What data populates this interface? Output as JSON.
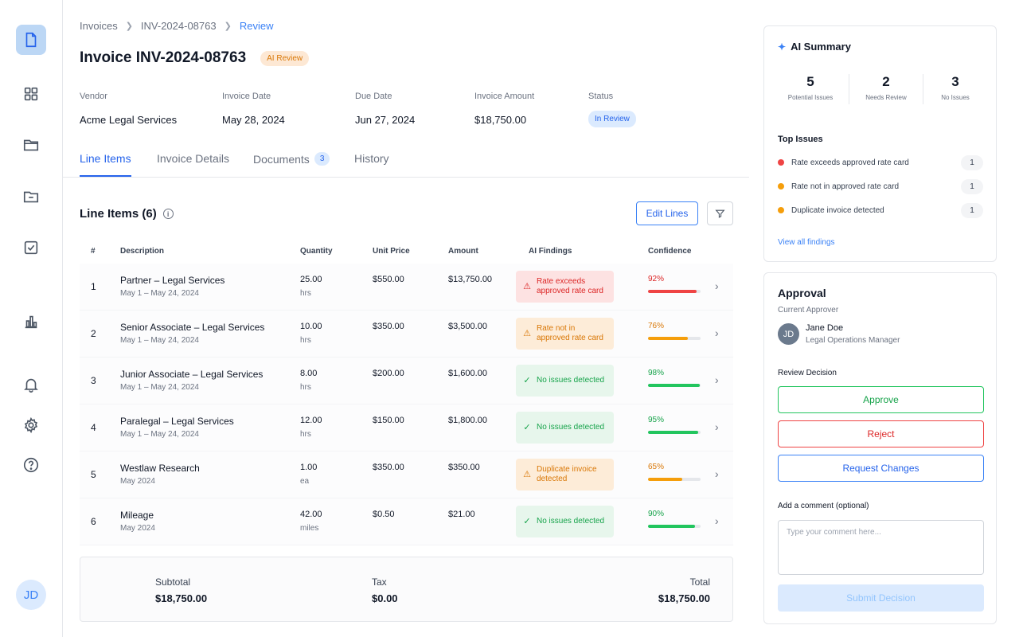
{
  "sidebar": {
    "icons": [
      "document-icon",
      "grid-icon",
      "folder-icon",
      "folder-icon",
      "checkbox-icon",
      "bar-chart-icon",
      "bell-icon",
      "gear-icon",
      "help-icon"
    ],
    "avatar": "JD"
  },
  "breadcrumb": {
    "items": [
      "Invoices",
      "INV-2024-08763",
      "Review"
    ]
  },
  "header": {
    "title": "Invoice INV-2024-08763",
    "badge": "AI Review"
  },
  "meta": {
    "vendor_label": "Vendor",
    "vendor": "Acme Legal Services",
    "invoice_date_label": "Invoice Date",
    "invoice_date": "May 28, 2024",
    "due_date_label": "Due Date",
    "due_date": "Jun 27, 2024",
    "amount_label": "Invoice Amount",
    "amount": "$18,750.00",
    "status_label": "Status",
    "status": "In Review"
  },
  "tabs": [
    {
      "label": "Line Items"
    },
    {
      "label": "Invoice Details"
    },
    {
      "label": "Documents",
      "count": "3"
    },
    {
      "label": "History"
    }
  ],
  "line_items": {
    "title": "Line Items (6)",
    "edit_label": "Edit Lines",
    "columns": [
      "#",
      "Description",
      "Quantity",
      "Unit Price",
      "Amount",
      "AI Findings",
      "Confidence"
    ],
    "rows": [
      {
        "num": "1",
        "desc": "Partner – Legal Services",
        "period": "May 1 – May 24, 2024",
        "qty": "25.00",
        "unit": "hrs",
        "price": "$550.00",
        "amount": "$13,750.00",
        "finding": "Rate exceeds approved rate card",
        "level": "red",
        "confidence": "92%",
        "conf_value": 0.92
      },
      {
        "num": "2",
        "desc": "Senior Associate – Legal Services",
        "period": "May 1 – May 24, 2024",
        "qty": "10.00",
        "unit": "hrs",
        "price": "$350.00",
        "amount": "$3,500.00",
        "finding": "Rate not in approved rate card",
        "level": "orange",
        "confidence": "76%",
        "conf_value": 0.76
      },
      {
        "num": "3",
        "desc": "Junior Associate – Legal Services",
        "period": "May 1 – May 24, 2024",
        "qty": "8.00",
        "unit": "hrs",
        "price": "$200.00",
        "amount": "$1,600.00",
        "finding": "No issues detected",
        "level": "green",
        "confidence": "98%",
        "conf_value": 0.98
      },
      {
        "num": "4",
        "desc": "Paralegal – Legal Services",
        "period": "May 1 – May 24, 2024",
        "qty": "12.00",
        "unit": "hrs",
        "price": "$150.00",
        "amount": "$1,800.00",
        "finding": "No issues detected",
        "level": "green",
        "confidence": "95%",
        "conf_value": 0.95
      },
      {
        "num": "5",
        "desc": "Westlaw Research",
        "period": "May 2024",
        "qty": "1.00",
        "unit": "ea",
        "price": "$350.00",
        "amount": "$350.00",
        "finding": "Duplicate invoice detected",
        "level": "orange",
        "confidence": "65%",
        "conf_value": 0.65
      },
      {
        "num": "6",
        "desc": "Mileage",
        "period": "May 2024",
        "qty": "42.00",
        "unit": "miles",
        "price": "$0.50",
        "amount": "$21.00",
        "finding": "No issues detected",
        "level": "green",
        "confidence": "90%",
        "conf_value": 0.9
      }
    ]
  },
  "totals": {
    "subtotal_label": "Subtotal",
    "subtotal": "$18,750.00",
    "tax_label": "Tax",
    "tax": "$0.00",
    "total_label": "Total",
    "total": "$18,750.00"
  },
  "ai_summary": {
    "title": "AI Summary",
    "stats": [
      {
        "value": "5",
        "label": "Potential Issues"
      },
      {
        "value": "2",
        "label": "Needs Review"
      },
      {
        "value": "3",
        "label": "No Issues"
      }
    ],
    "top_issues_label": "Top Issues",
    "issues": [
      {
        "label": "Rate exceeds approved rate card",
        "count": "1",
        "color": "#ef4444"
      },
      {
        "label": "Rate not in approved rate card",
        "count": "1",
        "color": "#f59e0b"
      },
      {
        "label": "Duplicate invoice detected",
        "count": "1",
        "color": "#f59e0b"
      }
    ],
    "view_all": "View all findings"
  },
  "approval": {
    "title": "Approval",
    "current_label": "Current Approver",
    "avatar": "JD",
    "name": "Jane Doe",
    "role": "Legal Operations Manager",
    "decision_label": "Review Decision",
    "approve": "Approve",
    "reject": "Reject",
    "changes": "Request Changes",
    "comment_label": "Add a comment (optional)",
    "comment_placeholder": "Type your comment here...",
    "submit": "Submit Decision"
  },
  "colors": {
    "red": "#ef4444",
    "orange": "#f59e0b",
    "green": "#22c55e",
    "accent": "#2563eb"
  }
}
